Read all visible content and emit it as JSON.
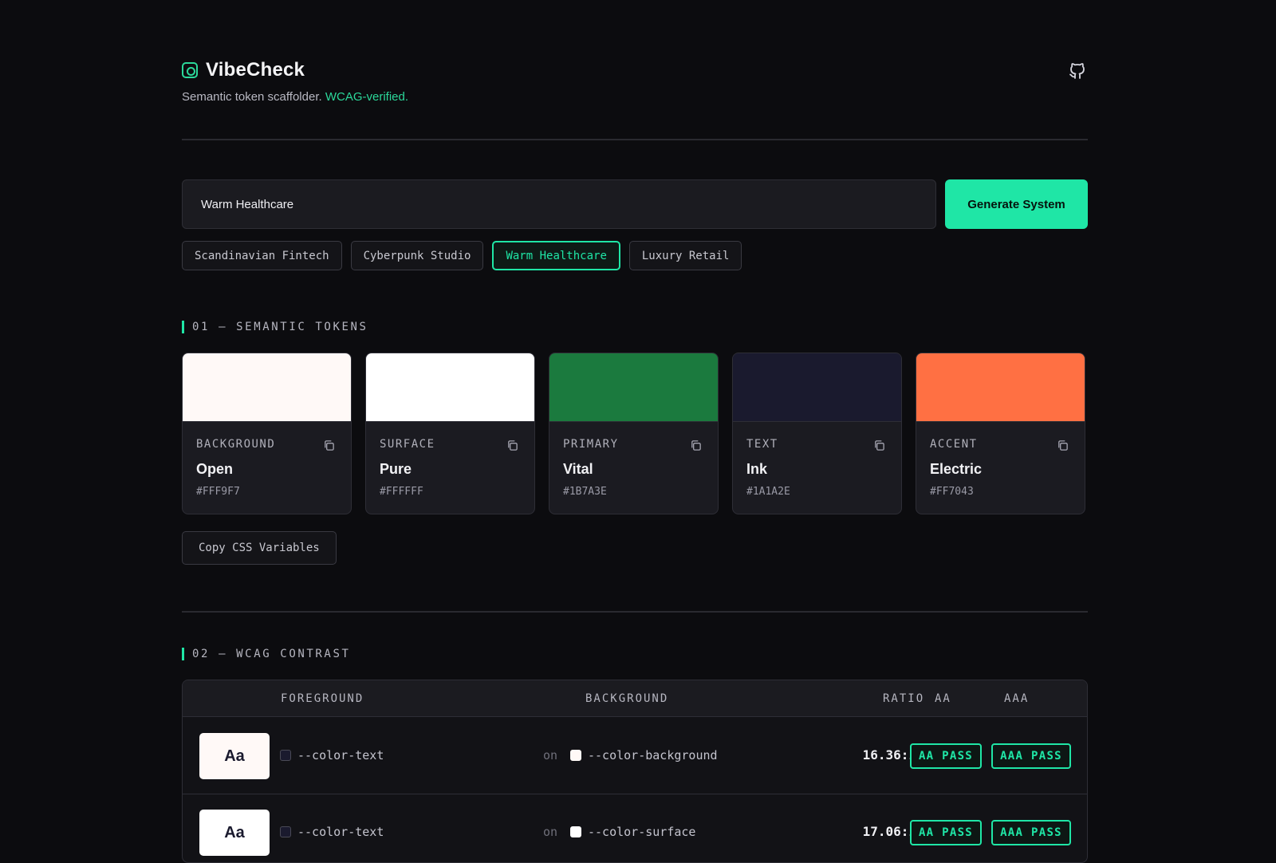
{
  "app": {
    "name": "VibeCheck",
    "tagline_prefix": "Semantic token scaffolder.",
    "tagline_accent": "WCAG-verified.",
    "accent_color": "#1fe6a6"
  },
  "prompt": {
    "value": "Warm Healthcare",
    "generate_label": "Generate System"
  },
  "presets": [
    {
      "label": "Scandinavian Fintech",
      "active": false
    },
    {
      "label": "Cyberpunk Studio",
      "active": false
    },
    {
      "label": "Warm Healthcare",
      "active": true
    },
    {
      "label": "Luxury Retail",
      "active": false
    }
  ],
  "tokens_section": {
    "title": "01 — SEMANTIC TOKENS",
    "tokens": [
      {
        "role": "BACKGROUND",
        "name": "Open",
        "hex": "#FFF9F7"
      },
      {
        "role": "SURFACE",
        "name": "Pure",
        "hex": "#FFFFFF"
      },
      {
        "role": "PRIMARY",
        "name": "Vital",
        "hex": "#1B7A3E"
      },
      {
        "role": "TEXT",
        "name": "Ink",
        "hex": "#1A1A2E"
      },
      {
        "role": "ACCENT",
        "name": "Electric",
        "hex": "#FF7043"
      }
    ],
    "copy_css_label": "Copy CSS Variables"
  },
  "contrast_section": {
    "title": "02 — WCAG CONTRAST",
    "headers": {
      "foreground": "FOREGROUND",
      "background": "BACKGROUND",
      "ratio": "RATIO",
      "aa": "AA",
      "aaa": "AAA"
    },
    "rows": [
      {
        "preview": "Aa",
        "fg": "--color-text",
        "fg_hex": "#1A1A2E",
        "on": "on",
        "bg": "--color-background",
        "bg_hex": "#FFF9F7",
        "ratio": "16.36:1",
        "aa": "AA PASS",
        "aaa": "AAA PASS"
      },
      {
        "preview": "Aa",
        "fg": "--color-text",
        "fg_hex": "#1A1A2E",
        "on": "on",
        "bg": "--color-surface",
        "bg_hex": "#FFFFFF",
        "ratio": "17.06:1",
        "aa": "AA PASS",
        "aaa": "AAA PASS"
      }
    ]
  },
  "icons": {
    "logo": "chip-icon",
    "github": "github-icon",
    "copy": "copy-icon"
  }
}
